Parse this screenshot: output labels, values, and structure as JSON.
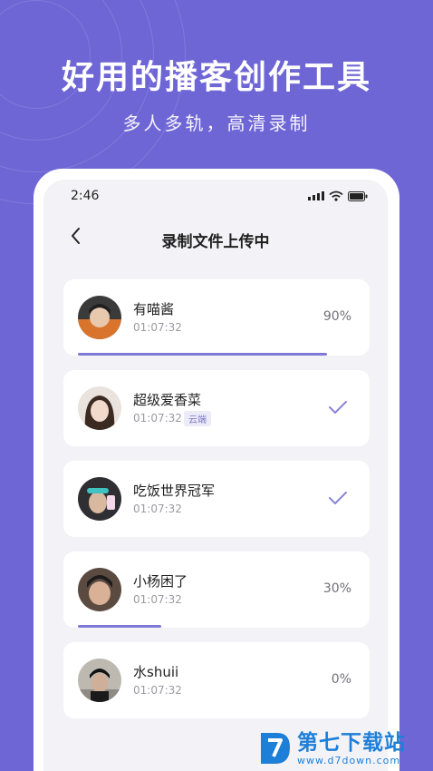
{
  "promo": {
    "headline": "好用的播客创作工具",
    "subline": "多人多轨，高清录制"
  },
  "status_bar": {
    "time": "2:46",
    "icons": [
      "signal-icon",
      "wifi-icon",
      "battery-icon"
    ]
  },
  "nav": {
    "back_icon": "chevron-left-icon",
    "title": "录制文件上传中"
  },
  "uploads": [
    {
      "name": "有喵酱",
      "duration": "01:07:32",
      "status": "90%",
      "progress": 0.9
    },
    {
      "name": "超级爱香菜",
      "duration": "01:07:32",
      "tag": "云端",
      "status": "done",
      "status_icon": "checkmark-icon"
    },
    {
      "name": "吃饭世界冠军",
      "duration": "01:07:32",
      "status": "done",
      "status_icon": "checkmark-icon"
    },
    {
      "name": "小杨困了",
      "duration": "01:07:32",
      "status": "30%",
      "progress": 0.3
    },
    {
      "name": "水shuii",
      "duration": "01:07:32",
      "status": "0%",
      "progress": 0
    }
  ],
  "watermark": {
    "name": "第七下载站",
    "url": "www.d7down.com"
  },
  "colors": {
    "background": "#6F66D6",
    "accent": "#7F78D6",
    "card": "#FFFFFF",
    "watermark": "#1E7FD8"
  }
}
